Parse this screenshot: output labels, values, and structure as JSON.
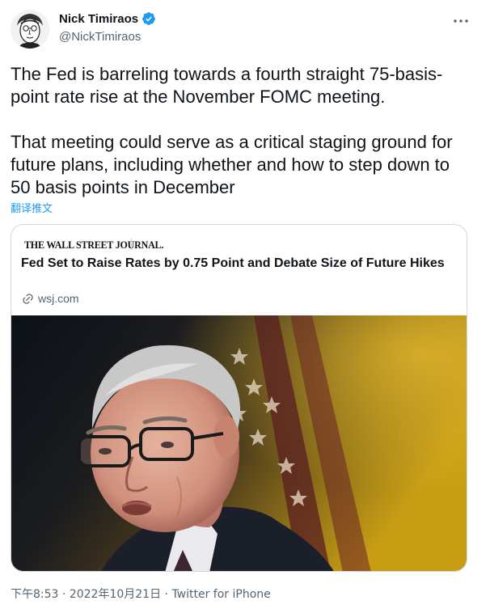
{
  "author": {
    "name": "Nick Timiraos",
    "handle": "@NickTimiraos",
    "verified": true
  },
  "tweet": {
    "paragraph_1": "The Fed is barreling towards a fourth straight 75-basis-point rate rise at the November FOMC meeting.",
    "paragraph_2": "That meeting could serve as a critical staging ground for future plans, including whether and how to step down to 50 basis points in December",
    "translate_label": "翻译推文"
  },
  "card": {
    "publisher": "THE WALL STREET JOURNAL.",
    "title": "Fed Set to Raise Rates by 0.75 Point and Debate Size of Future Hikes",
    "domain": "wsj.com"
  },
  "meta": {
    "time": "下午8:53",
    "separator": "·",
    "date": "2022年10月21日",
    "source": "Twitter for iPhone"
  },
  "colors": {
    "accent": "#1d9bf0",
    "secondary_text": "#536471",
    "border": "#cfd9de"
  },
  "icons": {
    "verified": "verified-badge-icon",
    "more": "more-horizontal-icon",
    "link": "link-icon"
  }
}
